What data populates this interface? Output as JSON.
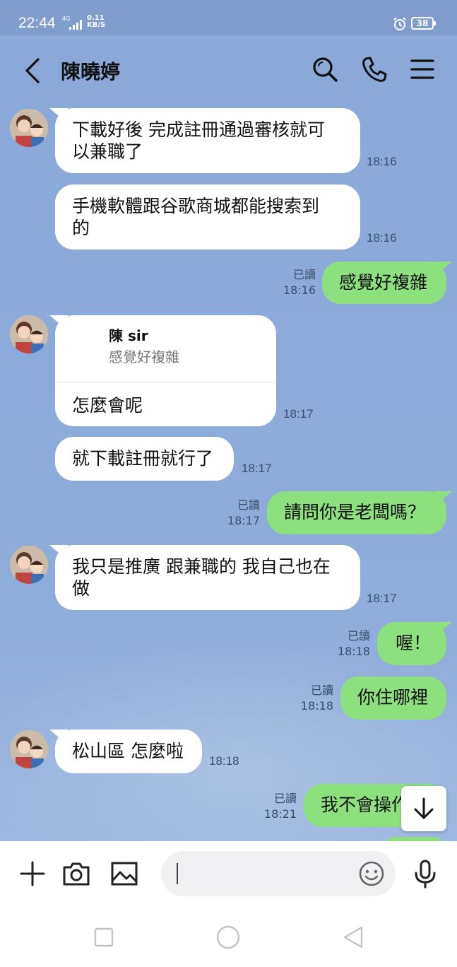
{
  "status_bar": {
    "time": "22:44",
    "network": "4G",
    "speed_value": "0.11",
    "speed_unit": "KB/S",
    "battery": "38"
  },
  "header": {
    "title": "陳曉婷"
  },
  "messages": [
    {
      "text_line1": "下載好後 完成註冊通過審核就可",
      "text_line2": "以兼職了",
      "time": "18:16"
    },
    {
      "text_line1": "手機軟體跟谷歌商城都能搜索到",
      "text_line2": "的",
      "time": "18:16"
    },
    {
      "read": "已讀",
      "time": "18:16",
      "text": "感覺好複雜"
    },
    {
      "quote_name": "陳 sir",
      "quote_text": "感覺好複雜",
      "text": "怎麼會呢",
      "time": "18:17"
    },
    {
      "text": "就下載註冊就行了",
      "time": "18:17"
    },
    {
      "read": "已讀",
      "time": "18:17",
      "text": "請問你是老闆嗎？"
    },
    {
      "text_line1": "我只是推廣 跟兼職的 我自己也在",
      "text_line2": "做",
      "time": "18:17"
    },
    {
      "read": "已讀",
      "time": "18:18",
      "text": "喔！"
    },
    {
      "read": "已讀",
      "time": "18:18",
      "text": "你住哪裡"
    },
    {
      "text": "松山區 怎麼啦",
      "time": "18:18"
    },
    {
      "read": "已讀",
      "time": "18:21",
      "text": "我不會操作"
    }
  ],
  "input": {
    "placeholder": ""
  },
  "colors": {
    "chat_background": "#8aa9d9",
    "outgoing_bubble": "#8de07e",
    "incoming_bubble": "#ffffff"
  },
  "icons": {
    "header": [
      "back-icon",
      "search-icon",
      "phone-icon",
      "menu-icon"
    ],
    "input_bar": [
      "plus-icon",
      "camera-icon",
      "image-icon",
      "emoji-icon",
      "microphone-icon"
    ],
    "nav": [
      "recent-apps-icon",
      "home-icon",
      "back-nav-icon"
    ],
    "chat": [
      "scroll-down-icon"
    ]
  }
}
